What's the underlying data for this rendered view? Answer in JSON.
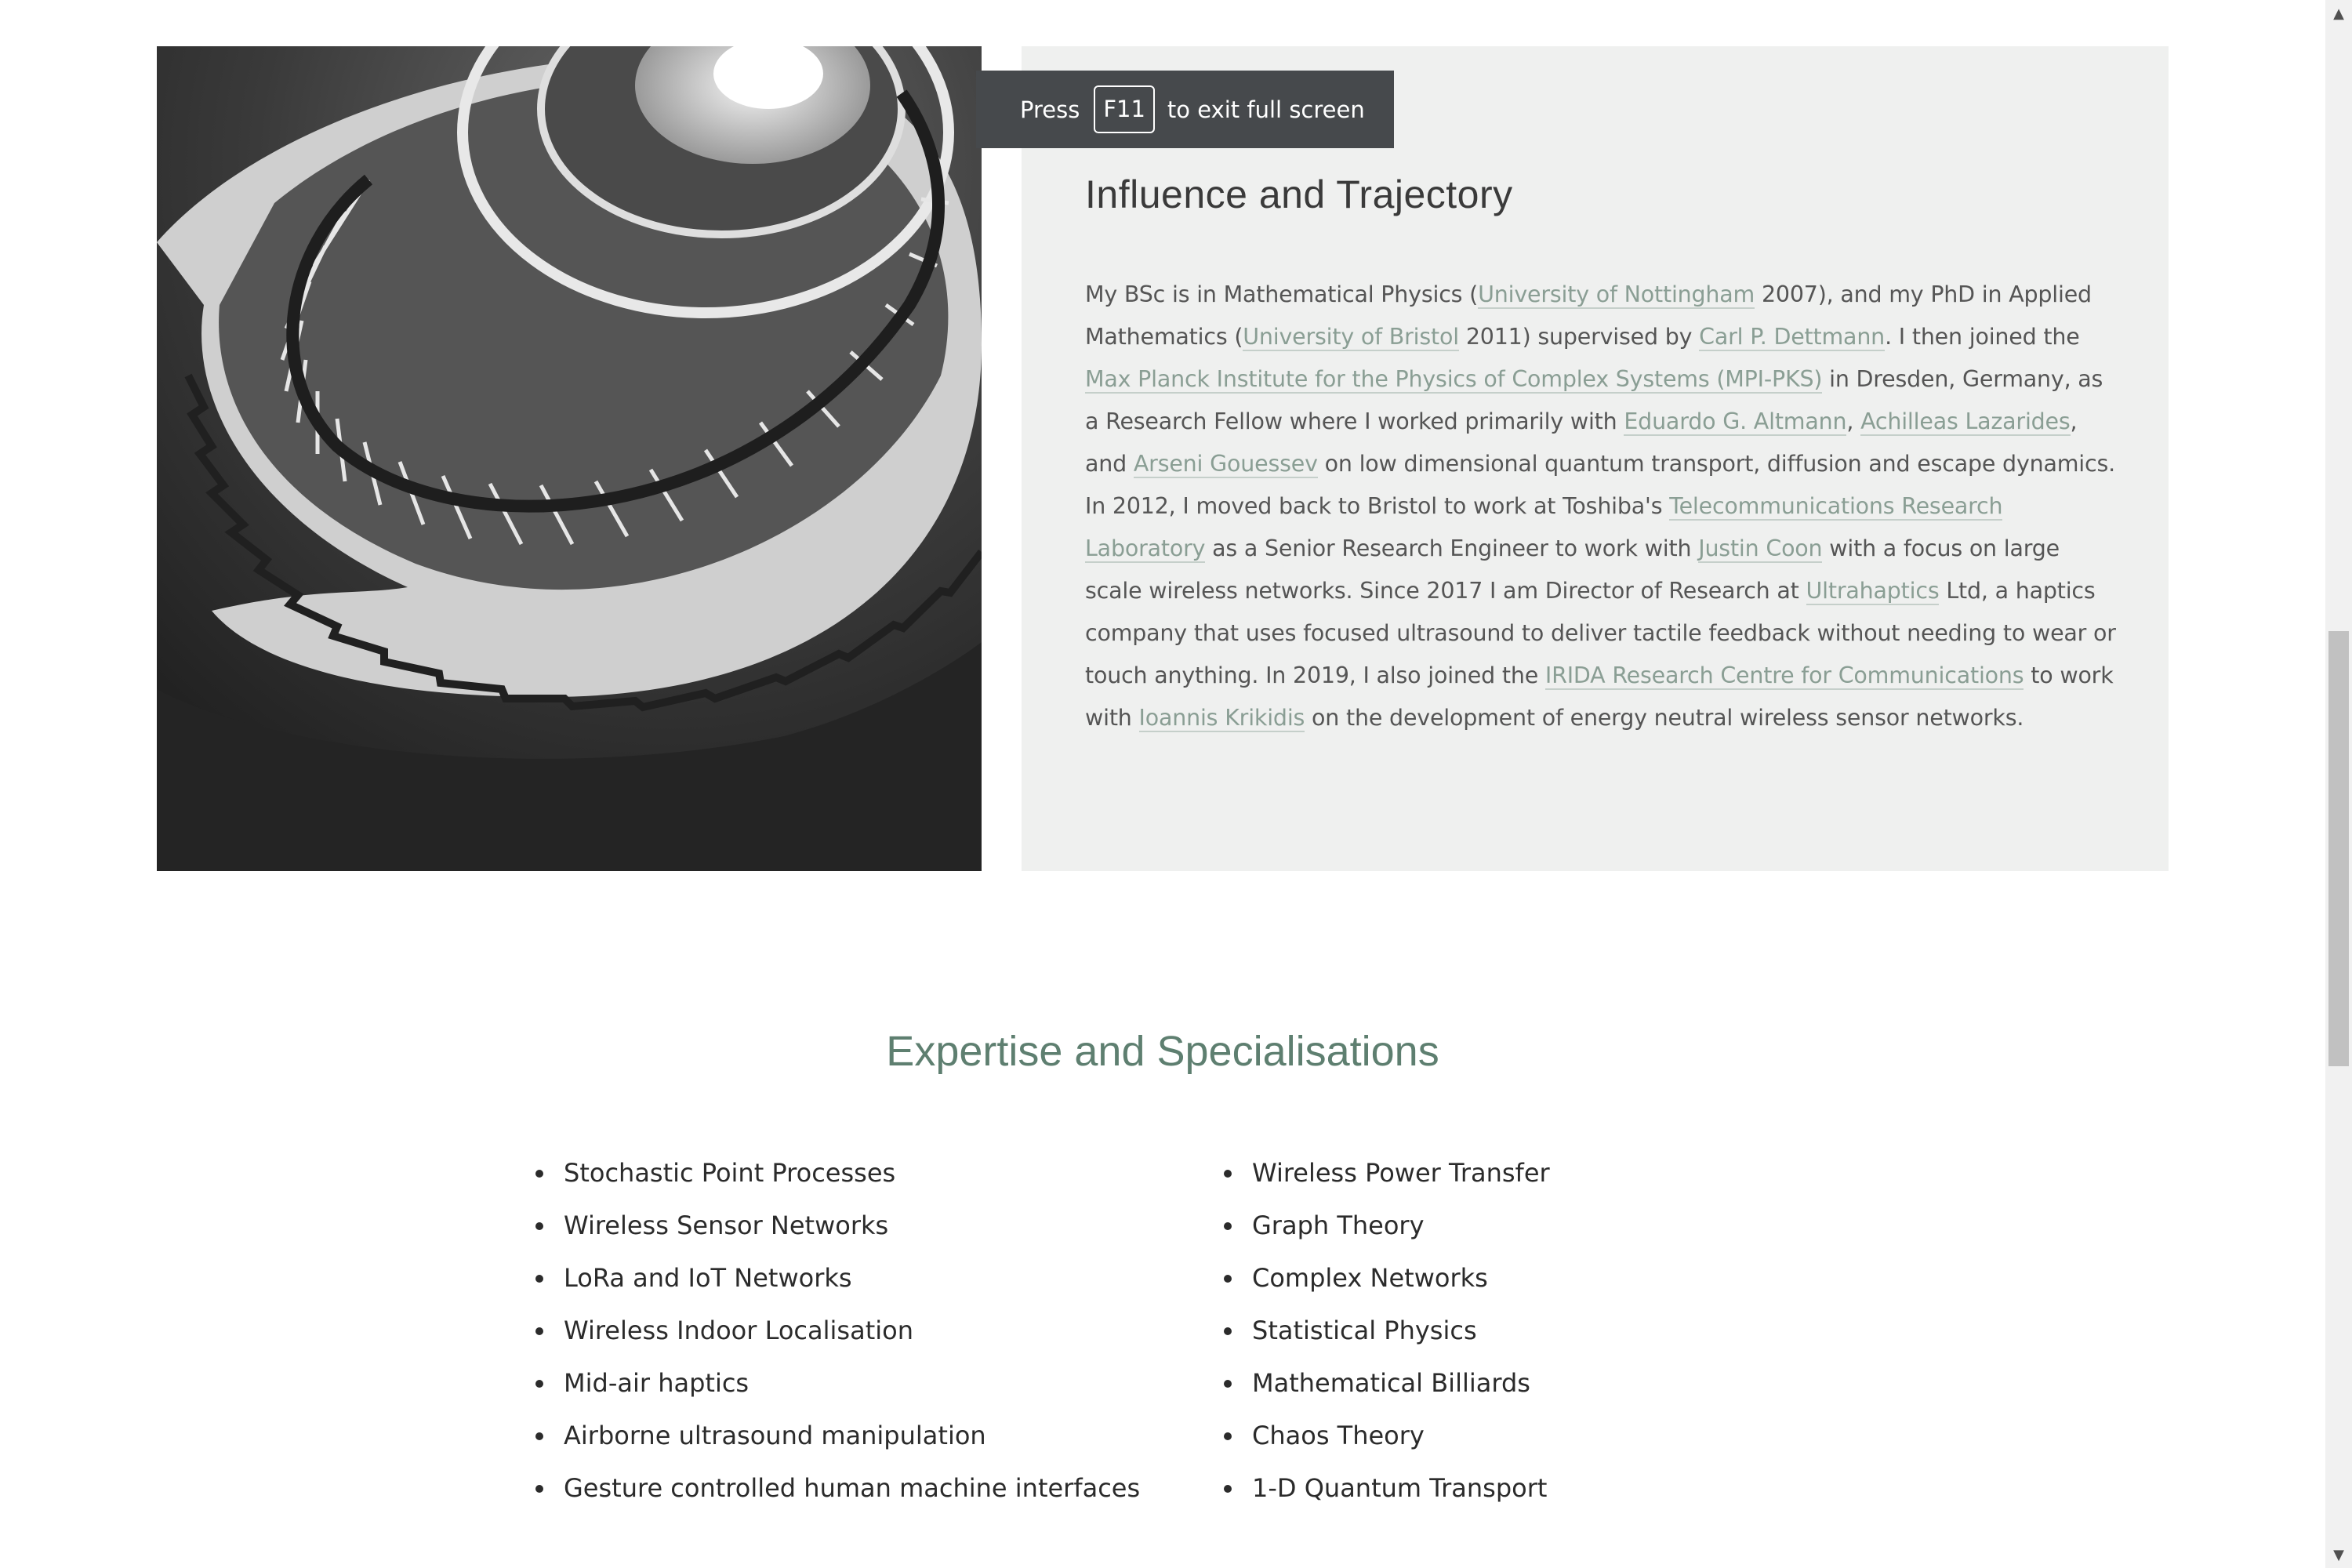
{
  "toast": {
    "press": "Press",
    "key": "F11",
    "rest": "to exit full screen"
  },
  "about": {
    "heading": "Influence and Trajectory",
    "bio": [
      {
        "t": "My BSc is in Mathematical Physics ("
      },
      {
        "t": "University of Nottingham",
        "link": true
      },
      {
        "t": " 2007), and my PhD in Applied Mathematics ("
      },
      {
        "t": "University of Bristol",
        "link": true
      },
      {
        "t": " 2011) supervised by "
      },
      {
        "t": "Carl P. Dettmann",
        "link": true
      },
      {
        "t": ". I then joined the "
      },
      {
        "t": "Max Planck Institute for the Physics of Complex Systems (MPI-PKS)",
        "link": true
      },
      {
        "t": " in Dresden, Germany, as a Research Fellow where I worked primarily with "
      },
      {
        "t": "Eduardo G. Altmann",
        "link": true
      },
      {
        "t": ", "
      },
      {
        "t": "Achilleas Lazarides",
        "link": true
      },
      {
        "t": ", and "
      },
      {
        "t": "Arseni Gouessev",
        "link": true
      },
      {
        "t": " on low dimensional quantum transport, diffusion and escape dynamics. In 2012, I moved back to Bristol to work at Toshiba's "
      },
      {
        "t": "Telecommunications Research Laboratory",
        "link": true
      },
      {
        "t": " as a Senior Research Engineer to work with "
      },
      {
        "t": "Justin Coon",
        "link": true
      },
      {
        "t": " with a focus on large scale wireless networks. Since 2017 I am Director of Research at "
      },
      {
        "t": "Ultrahaptics",
        "link": true
      },
      {
        "t": " Ltd, a haptics company that uses focused ultrasound to deliver tactile feedback without needing to wear or touch anything. In 2019, I also joined the "
      },
      {
        "t": "IRIDA Research Centre for Communications",
        "link": true
      },
      {
        "t": " to work with "
      },
      {
        "t": "Ioannis Krikidis",
        "link": true
      },
      {
        "t": " on the development of energy neutral wireless sensor networks."
      }
    ]
  },
  "expertise": {
    "title": "Expertise and Specialisations",
    "left": [
      "Stochastic Point Processes",
      "Wireless Sensor Networks",
      "LoRa and IoT Networks",
      "Wireless Indoor Localisation",
      "Mid-air haptics",
      "Airborne ultrasound manipulation",
      "Gesture controlled human machine interfaces"
    ],
    "right": [
      "Wireless Power Transfer",
      "Graph Theory",
      "Complex Networks",
      "Statistical Physics",
      "Mathematical Billiards",
      "Chaos Theory",
      "1-D Quantum Transport"
    ]
  },
  "scrollbar": {
    "up_icon": "arrow-up-icon",
    "down_icon": "arrow-down-icon",
    "up_glyph": "▲",
    "down_glyph": "▼",
    "scroll_fraction": 0.56
  },
  "colors": {
    "accent": "#5e7f70",
    "link": "#8a9e94",
    "panel_bg": "#eff0ef",
    "toast_bg": "#46494c"
  }
}
